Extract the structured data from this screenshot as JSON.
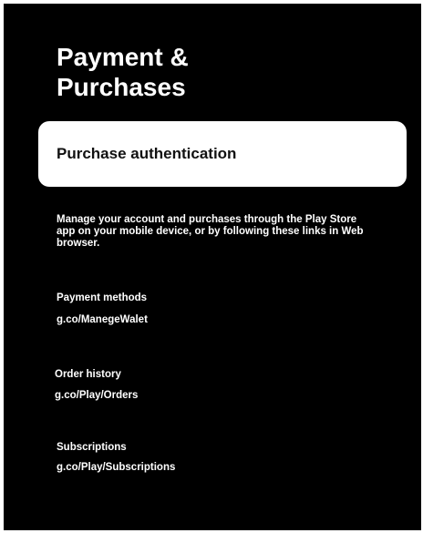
{
  "screen": {
    "title_line1": "Payment &",
    "title_line2": "Purchases",
    "selected_item": "Purchase authentication",
    "description": "Manage your account and purchases through the Play Store app on your mobile device, or by following these links in Web browser.",
    "sections": [
      {
        "label": "Payment methods",
        "link": "g.co/ManegeWalet"
      },
      {
        "label": "Order history",
        "link": "g.co/Play/Orders"
      },
      {
        "label": "Subscriptions",
        "link": "g.co/Play/Subscriptions"
      }
    ]
  }
}
